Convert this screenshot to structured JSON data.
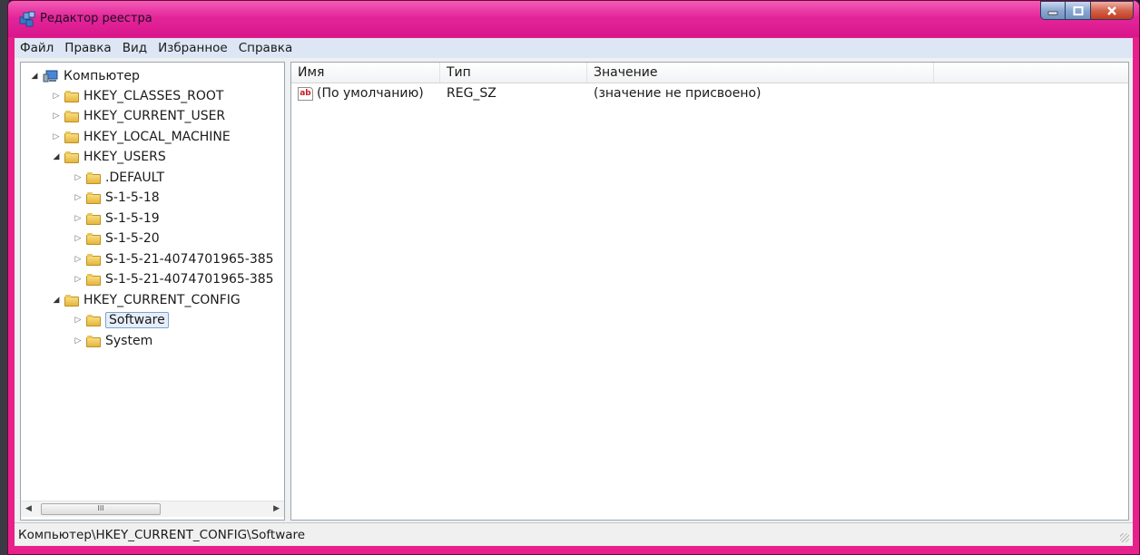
{
  "window": {
    "title": "Редактор реестра",
    "accent_color": "#e4259a"
  },
  "menu": [
    "Файл",
    "Правка",
    "Вид",
    "Избранное",
    "Справка"
  ],
  "tree": {
    "root": "Компьютер",
    "items": [
      {
        "label": "HKEY_CLASSES_ROOT",
        "expanded": false
      },
      {
        "label": "HKEY_CURRENT_USER",
        "expanded": false
      },
      {
        "label": "HKEY_LOCAL_MACHINE",
        "expanded": false
      },
      {
        "label": "HKEY_USERS",
        "expanded": true
      },
      {
        "label": ".DEFAULT",
        "expanded": false
      },
      {
        "label": "S-1-5-18",
        "expanded": false
      },
      {
        "label": "S-1-5-19",
        "expanded": false
      },
      {
        "label": "S-1-5-20",
        "expanded": false
      },
      {
        "label": "S-1-5-21-4074701965-385",
        "expanded": false
      },
      {
        "label": "S-1-5-21-4074701965-385",
        "expanded": false
      },
      {
        "label": "HKEY_CURRENT_CONFIG",
        "expanded": true
      },
      {
        "label": "Software",
        "expanded": false,
        "selected": true
      },
      {
        "label": "System",
        "expanded": false
      }
    ],
    "scroll_thumb_glyph": "III"
  },
  "list": {
    "columns": [
      "Имя",
      "Тип",
      "Значение"
    ],
    "rows": [
      {
        "icon": "ab",
        "name": "(По умолчанию)",
        "type": "REG_SZ",
        "value": "(значение не присвоено)"
      }
    ]
  },
  "status": "Компьютер\\HKEY_CURRENT_CONFIG\\Software"
}
